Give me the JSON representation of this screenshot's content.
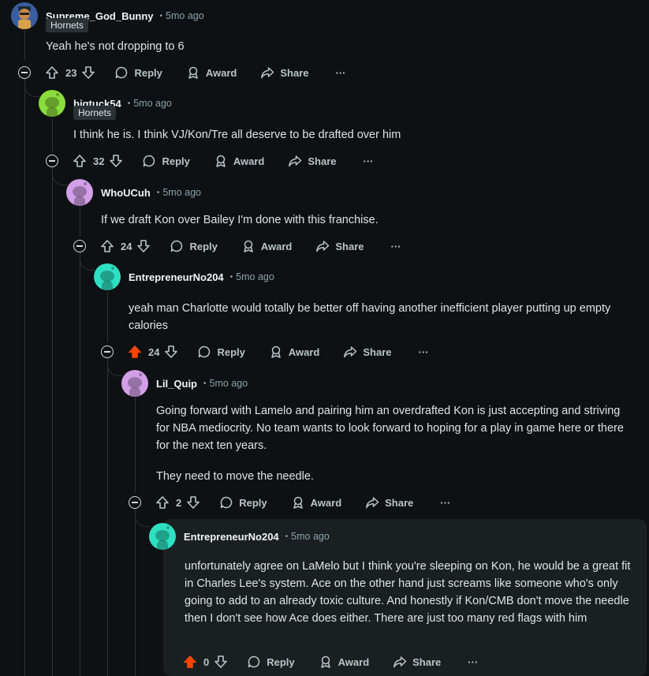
{
  "colors": {
    "background": "#0e1113",
    "upvoted": "#ff4500",
    "thread_line": "#2f3336",
    "highlight_bg": "#1a2022"
  },
  "action_labels": {
    "reply": "Reply",
    "award": "Award",
    "share": "Share",
    "more": "···"
  },
  "comments": [
    {
      "username": "Supreme_God_Bunny",
      "dot": "•",
      "time": "5mo ago",
      "flair": "Hornets",
      "body": [
        "Yeah he's not dropping to 6"
      ],
      "votes": "23",
      "upvoted": false,
      "avatar_color": "#3a5fa0",
      "avatar_icon": "custom-avatar-icon"
    },
    {
      "username": "bigtuck54",
      "dot": "•",
      "time": "5mo ago",
      "flair": "Hornets",
      "body": [
        "I think he is. I think VJ/Kon/Tre all deserve to be drafted over him"
      ],
      "votes": "32",
      "upvoted": false,
      "avatar_color": "#8bdc3c",
      "avatar_icon": "snoo-icon"
    },
    {
      "username": "WhoUCuh",
      "dot": "•",
      "time": "5mo ago",
      "body": [
        "If we draft Kon over Bailey I'm done with this franchise."
      ],
      "votes": "24",
      "upvoted": false,
      "avatar_color": "#d29fe8",
      "avatar_icon": "snoo-icon"
    },
    {
      "username": "EntrepreneurNo204",
      "dot": "•",
      "time": "5mo ago",
      "body": [
        "yeah man Charlotte would totally be better off having another inefficient player putting up empty calories"
      ],
      "votes": "24",
      "upvoted": true,
      "avatar_color": "#2ee0c2",
      "avatar_icon": "snoo-icon"
    },
    {
      "username": "Lil_Quip",
      "dot": "•",
      "time": "5mo ago",
      "body": [
        "Going forward with Lamelo and pairing him an overdrafted Kon is just accepting and striving for NBA mediocrity. No team wants to look forward to hoping for a play in game here or there for the next ten years.",
        "They need to move the needle."
      ],
      "votes": "2",
      "upvoted": false,
      "avatar_color": "#d29fe8",
      "avatar_icon": "snoo-icon"
    },
    {
      "username": "EntrepreneurNo204",
      "dot": "•",
      "time": "5mo ago",
      "body": [
        "unfortunately agree on LaMelo but I think you're sleeping on Kon, he would be a great fit in Charles Lee's system. Ace on the other hand just screams like someone who's only going to add to an already toxic culture. And honestly if Kon/CMB don't move the needle then I don't see how Ace does either. There are just too many red flags with him"
      ],
      "votes": "0",
      "upvoted": true,
      "avatar_color": "#2ee0c2",
      "avatar_icon": "snoo-icon"
    }
  ]
}
